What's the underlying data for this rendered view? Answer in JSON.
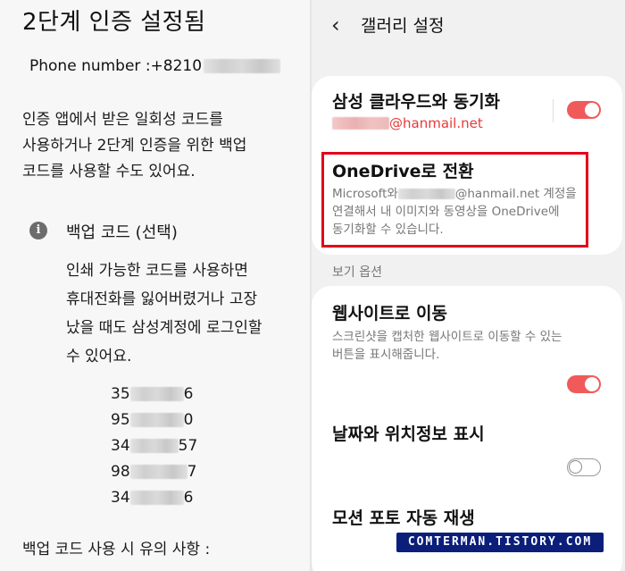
{
  "left": {
    "title": "2단계 인증 설정됨",
    "phone_label": "Phone number : ",
    "phone_prefix": "+8210",
    "intro_lines": [
      "인증 앱에서 받은 일회성 코드를",
      "사용하거나 2단계 인증을 위한 백업",
      "코드를 사용할 수도 있어요."
    ],
    "info_icon": "info-icon",
    "backup_title": "백업 코드 (선택)",
    "backup_lines": [
      "인쇄 가능한 코드를 사용하면",
      "휴대전화를 잃어버렸거나 고장",
      "났을 때도 삼성계정에 로그인할",
      "수 있어요."
    ],
    "codes": [
      {
        "start": "35",
        "end": "6"
      },
      {
        "start": "95",
        "end": "0"
      },
      {
        "start": "34",
        "end": "57"
      },
      {
        "start": "98",
        "end": "7"
      },
      {
        "start": "34",
        "end": "6"
      }
    ],
    "footer": "백업 코드 사용 시 유의 사항 :"
  },
  "right": {
    "back_icon": "chevron-left-icon",
    "title": "갤러리 설정",
    "sync": {
      "title": "삼성 클라우드와 동기화",
      "email_suffix": "@hanmail.net",
      "enabled": true
    },
    "onedrive": {
      "title": "OneDrive로 전환",
      "desc_prefix": "Microsoft와 ",
      "desc_email": "@hanmail.net 계정을",
      "desc_line2": "연결해서 내 이미지와 동영상을 OneDrive에",
      "desc_line3": "동기화할 수 있습니다."
    },
    "section_label": "보기 옵션",
    "website": {
      "title": "웹사이트로 이동",
      "desc_line1": "스크린샷을 캡처한 웹사이트로 이동할 수 있는",
      "desc_line2": "버튼을 표시해줍니다.",
      "enabled": true
    },
    "location": {
      "title": "날짜와 위치정보 표시",
      "enabled": false
    },
    "motion": {
      "title": "모션 포토 자동 재생"
    },
    "watermark": "COMTERMAN.TISTORY.COM",
    "colors": {
      "accent": "#f05a5a",
      "highlight": "#e3001b",
      "watermark_bg": "#0a1e7a"
    }
  }
}
